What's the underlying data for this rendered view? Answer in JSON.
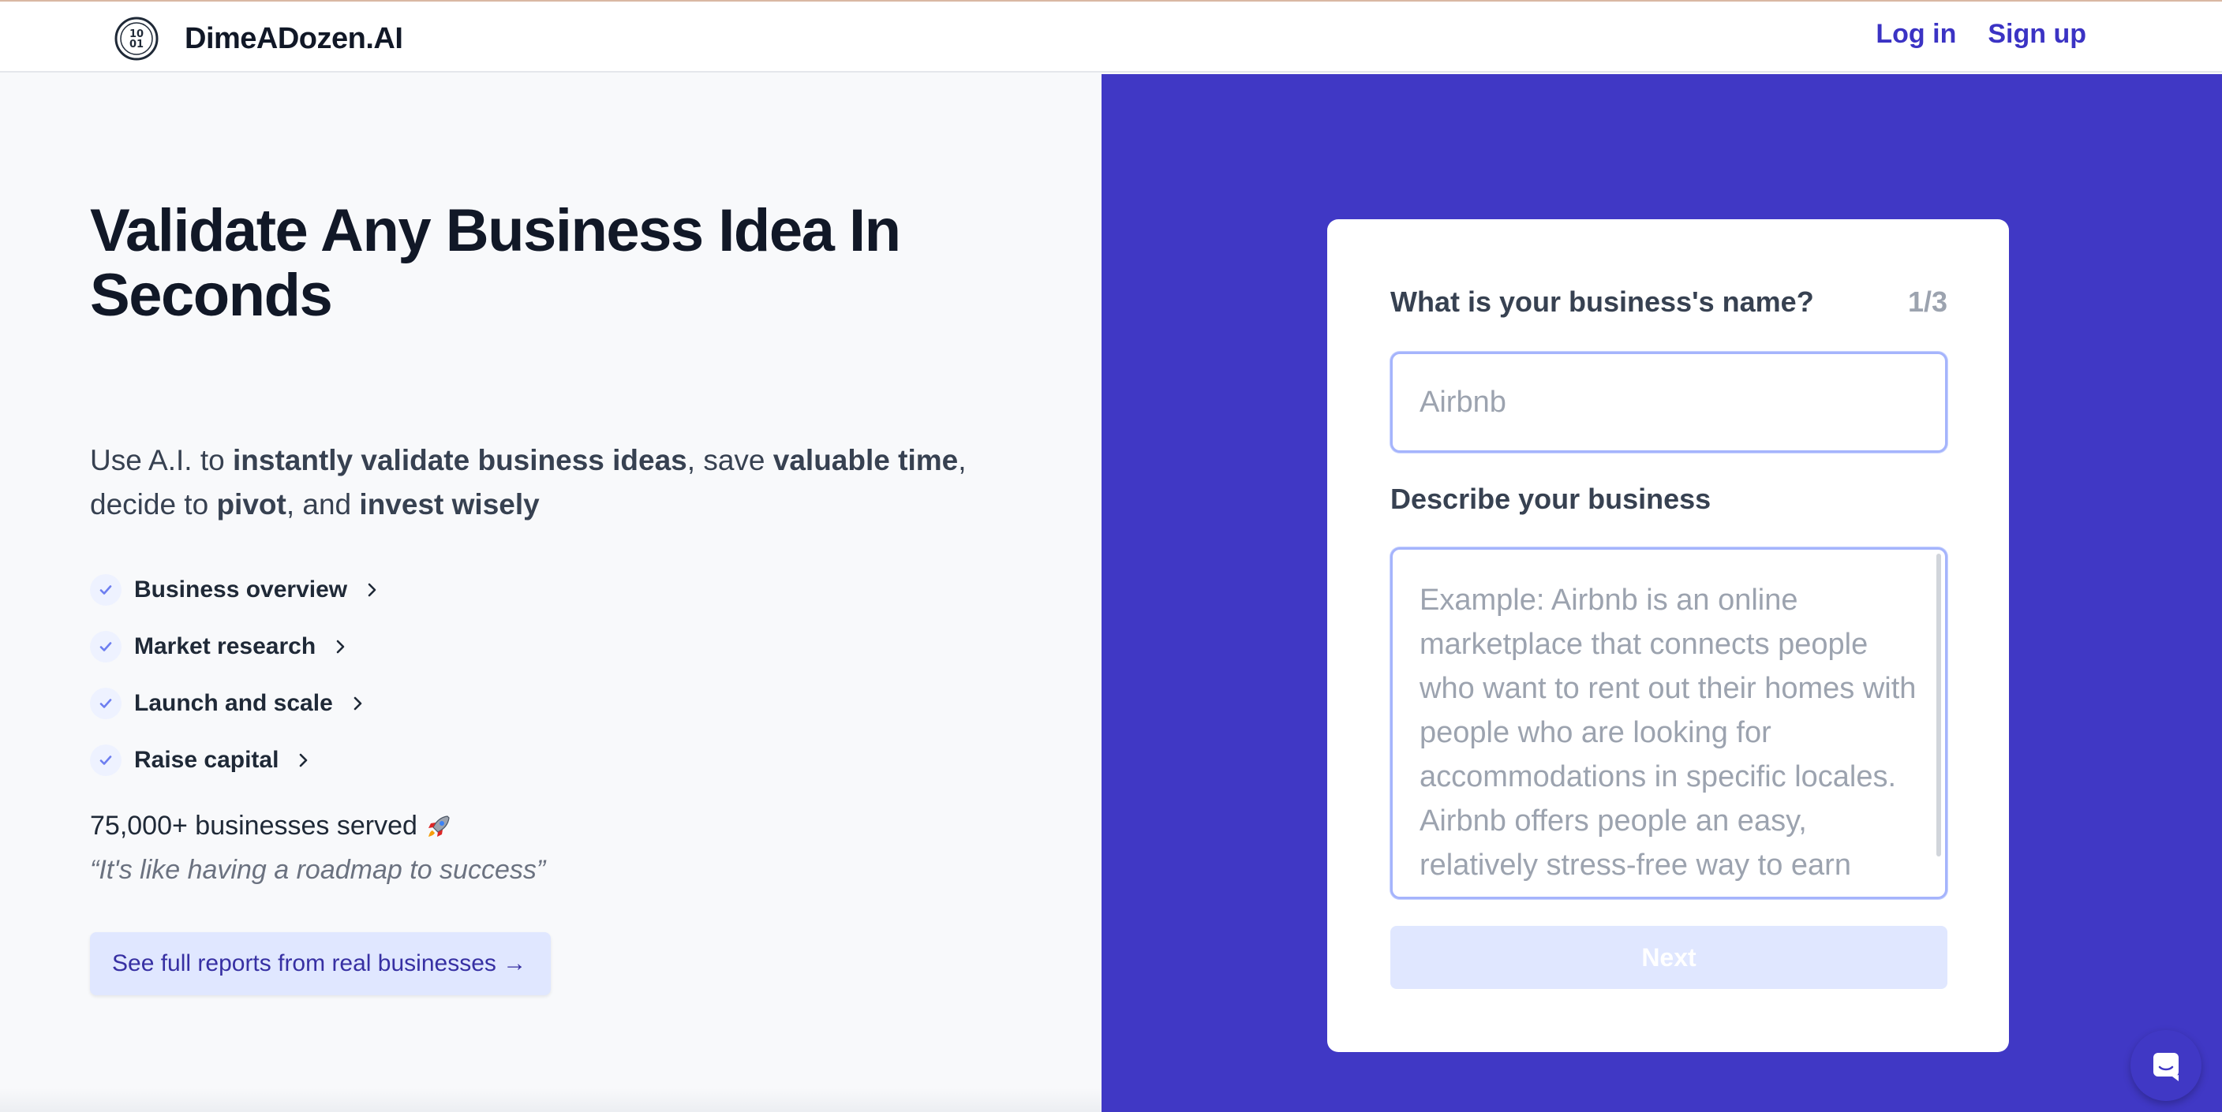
{
  "header": {
    "brand": "DimeADozen.AI",
    "logo_icon": "coin-1001-icon",
    "login_label": "Log in",
    "signup_label": "Sign up"
  },
  "hero": {
    "title": "Validate Any Business Idea In Seconds",
    "subtitle_parts": [
      {
        "text": "Use A.I. to ",
        "bold": false
      },
      {
        "text": "instantly validate business ideas",
        "bold": true
      },
      {
        "text": ", save ",
        "bold": false
      },
      {
        "text": "valuable time",
        "bold": true
      },
      {
        "text": ", decide to ",
        "bold": false
      },
      {
        "text": "pivot",
        "bold": true
      },
      {
        "text": ", and ",
        "bold": false
      },
      {
        "text": "invest wisely",
        "bold": true
      }
    ],
    "features": [
      {
        "label": "Business overview"
      },
      {
        "label": "Market research"
      },
      {
        "label": "Launch and scale"
      },
      {
        "label": "Raise capital"
      }
    ],
    "served_text": "75,000+ businesses served",
    "served_icon": "rocket-icon",
    "quote": "“It's like having a roadmap to success”",
    "reports_button": "See full reports from real businesses →"
  },
  "form": {
    "name_question": "What is your business's name?",
    "step": "1/3",
    "name_value": "",
    "name_placeholder": "Airbnb",
    "describe_label": "Describe your business",
    "describe_value": "",
    "describe_placeholder": "Example: Airbnb is an online marketplace that connects people who want to rent out their homes with people who are looking for accommodations in specific locales. Airbnb offers people an easy, relatively stress-free way to earn some income from their property.",
    "next_label": "Next"
  },
  "colors": {
    "brand_purple": "#4038c5",
    "link": "#3b33c4",
    "soft_indigo": "#e0e7ff",
    "input_border": "#a5b4fc"
  },
  "widgets": {
    "chat_icon": "chat-bubble-icon"
  }
}
